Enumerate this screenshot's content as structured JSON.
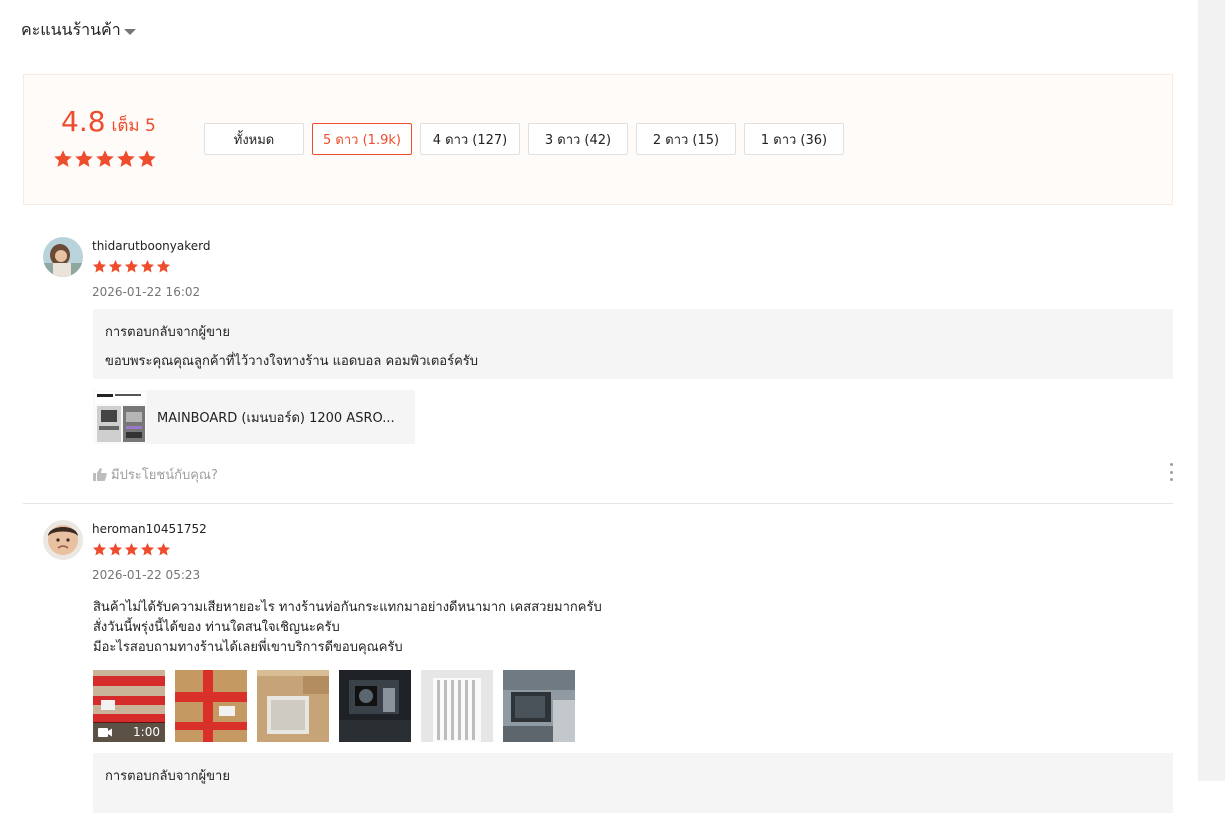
{
  "ratings": {
    "heading": "คะแนนร้านค้า",
    "average": "4.8",
    "out_of": "เต็ม 5",
    "average_stars": 5,
    "filters": [
      {
        "label": "ทั้งหมด",
        "active": false
      },
      {
        "label": "5 ดาว (1.9k)",
        "active": true
      },
      {
        "label": "4 ดาว (127)",
        "active": false
      },
      {
        "label": "3 ดาว (42)",
        "active": false
      },
      {
        "label": "2 ดาว (15)",
        "active": false
      },
      {
        "label": "1 ดาว (36)",
        "active": false
      }
    ]
  },
  "reviews": [
    {
      "username": "thidarutboonyakerd",
      "stars": 5,
      "date": "2026-01-22 16:02",
      "seller_reply_title": "การตอบกลับจากผู้ขาย",
      "seller_reply_text": "ขอบพระคุณคุณลูกค้าที่ไว้วางใจทางร้าน แอดบอล คอมพิวเตอร์ครับ",
      "product_name": "MAINBOARD (เมนบอร์ด) 1200 ASRO...",
      "helpful_label": "มีประโยชน์กับคุณ?"
    },
    {
      "username": "heroman10451752",
      "stars": 5,
      "date": "2026-01-22 05:23",
      "comment_lines": [
        "สินค้าไม่ได้รับความเสียหายอะไร ทางร้านห่อกันกระแทกมาอย่างดีหนามาก เคสสวยมากครับ",
        "สั่งวันนี้พรุ่งนี้ได้ของ  ท่านใดสนใจเชิญนะครับ",
        "มีอะไรสอบถามทางร้านได้เลยพี่เขาบริการดีขอบคุณครับ"
      ],
      "video_duration": "1:00",
      "seller_reply_title": "การตอบกลับจากผู้ขาย"
    }
  ],
  "colors": {
    "accent": "#ee4d2d",
    "summary_bg": "#fffbf8",
    "reply_bg": "#f5f5f5"
  },
  "icons": [
    "star-icon",
    "thumb-up-icon",
    "more-vertical-icon",
    "video-camera-icon",
    "caret-down-icon"
  ]
}
